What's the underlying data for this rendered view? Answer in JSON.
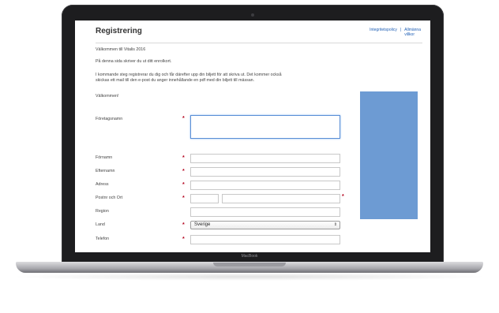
{
  "device": {
    "brand_label": "MacBook"
  },
  "page": {
    "title": "Registrering",
    "header_links": {
      "privacy": "Integritetspolicy",
      "separator": "|",
      "terms_line1": "Allmänna",
      "terms_line2": "villkor"
    },
    "welcome_line": "Välkommen till Vitalis 2016",
    "intro_line": "På denna sida skriver du ut ditt enrolkort.",
    "info_line1": "I kommande steg registrerar du dig och får därefter upp din biljett för att skriva ut. Det kommer också",
    "info_line2": "skickas ett mail till den e-post du anger innehållande en pdf med din biljett till mässan.",
    "greeting": "Välkommen!"
  },
  "form": {
    "company_label": "Företagsnamn",
    "first_name_label": "Förnamn",
    "last_name_label": "Efternamn",
    "address_label": "Adress",
    "zip_city_label": "Postnr och Ort",
    "region_label": "Region",
    "country_label": "Land",
    "country_value": "Sverige",
    "phone_label": "Telefon",
    "required_marker": "*"
  },
  "colors": {
    "accent_blue": "#6d9bd3",
    "required_red": "#b3001b",
    "link_blue": "#1f5fb5"
  },
  "icons": {
    "select_arrow": "select-arrows-icon"
  }
}
